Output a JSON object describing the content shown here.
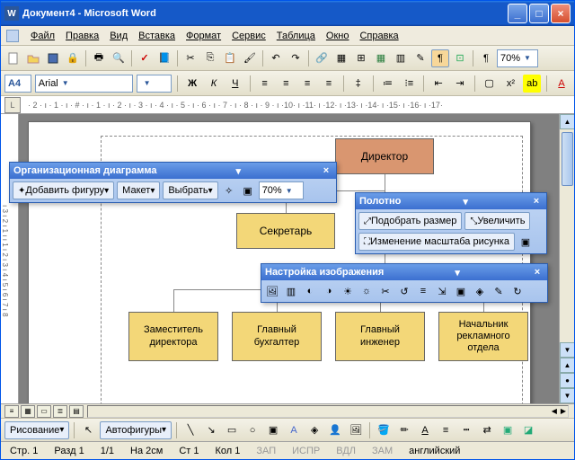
{
  "title": "Документ4 - Microsoft Word",
  "menu": [
    "Файл",
    "Правка",
    "Вид",
    "Вставка",
    "Формат",
    "Сервис",
    "Таблица",
    "Окно",
    "Справка"
  ],
  "zoom": "70%",
  "font": {
    "name": "Arial",
    "styleCombo": "A4"
  },
  "ruler": "· 2 · ı · 1 · ı · # · ı · 1 · ı · 2 · ı · 3 · ı · 4 · ı · 5 · ı · 6 · ı · 7 · ı · 8 · ı · 9 · ı ·10· ı ·11· ı ·12· ı ·13· ı ·14· ı ·15· ı ·16· ı ·17·",
  "vruler": "ı 3 ı 2 ı 1 ı  ı 1 ı 2 ı 3 ı 4 ı 5 ı 6 ı 7 ı 8",
  "org": {
    "director": "Директор",
    "secretary": "Секретарь",
    "dept1": "Заместитель директора",
    "dept2": "Главный бухгалтер",
    "dept3": "Главный инженер",
    "dept4": "Начальник рекламного отдела"
  },
  "toolbars": {
    "orgChart": {
      "title": "Организационная диаграмма",
      "addShape": "Добавить фигуру",
      "layout": "Макет",
      "select": "Выбрать",
      "zoom": "70%"
    },
    "canvas": {
      "title": "Полотно",
      "fit": "Подобрать размер",
      "expand": "Увеличить",
      "scale": "Изменение масштаба рисунка"
    },
    "picture": {
      "title": "Настройка изображения"
    }
  },
  "draw": {
    "menu": "Рисование",
    "autoshapes": "Автофигуры"
  },
  "status": {
    "page": "Стр. 1",
    "sec": "Разд 1",
    "pages": "1/1",
    "at": "На 2см",
    "line": "Ст 1",
    "col": "Кол 1",
    "rec": "ЗАП",
    "trk": "ИСПР",
    "ext": "ВДЛ",
    "ovr": "ЗАМ",
    "lang": "английский"
  }
}
